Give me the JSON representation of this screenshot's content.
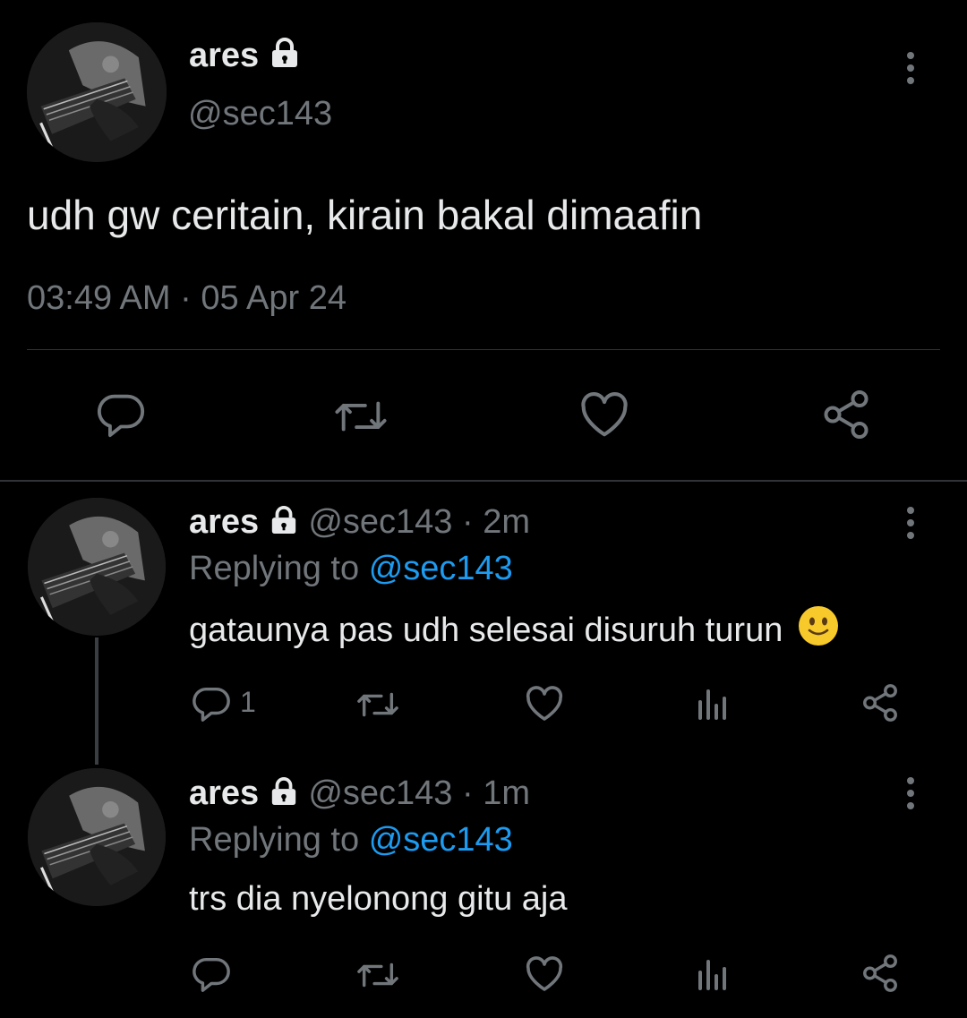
{
  "main_tweet": {
    "display_name": "ares",
    "handle": "@sec143",
    "text": "udh gw ceritain, kirain bakal dimaafin",
    "timestamp": "03:49 AM · 05 Apr 24"
  },
  "replies": [
    {
      "display_name": "ares",
      "handle_time": "@sec143 · 2m",
      "replying_prefix": "Replying to",
      "replying_handle": "@sec143",
      "text": "gataunya pas udh selesai disuruh turun",
      "emoji": "🙂",
      "reply_count": "1"
    },
    {
      "display_name": "ares",
      "handle_time": "@sec143 · 1m",
      "replying_prefix": "Replying to",
      "replying_handle": "@sec143",
      "text": "trs dia nyelonong gitu aja",
      "reply_count": ""
    }
  ],
  "colors": {
    "background": "#000000",
    "text": "#e7e9ea",
    "muted": "#71767b",
    "link": "#1d9bf0",
    "divider": "#2f3336"
  }
}
